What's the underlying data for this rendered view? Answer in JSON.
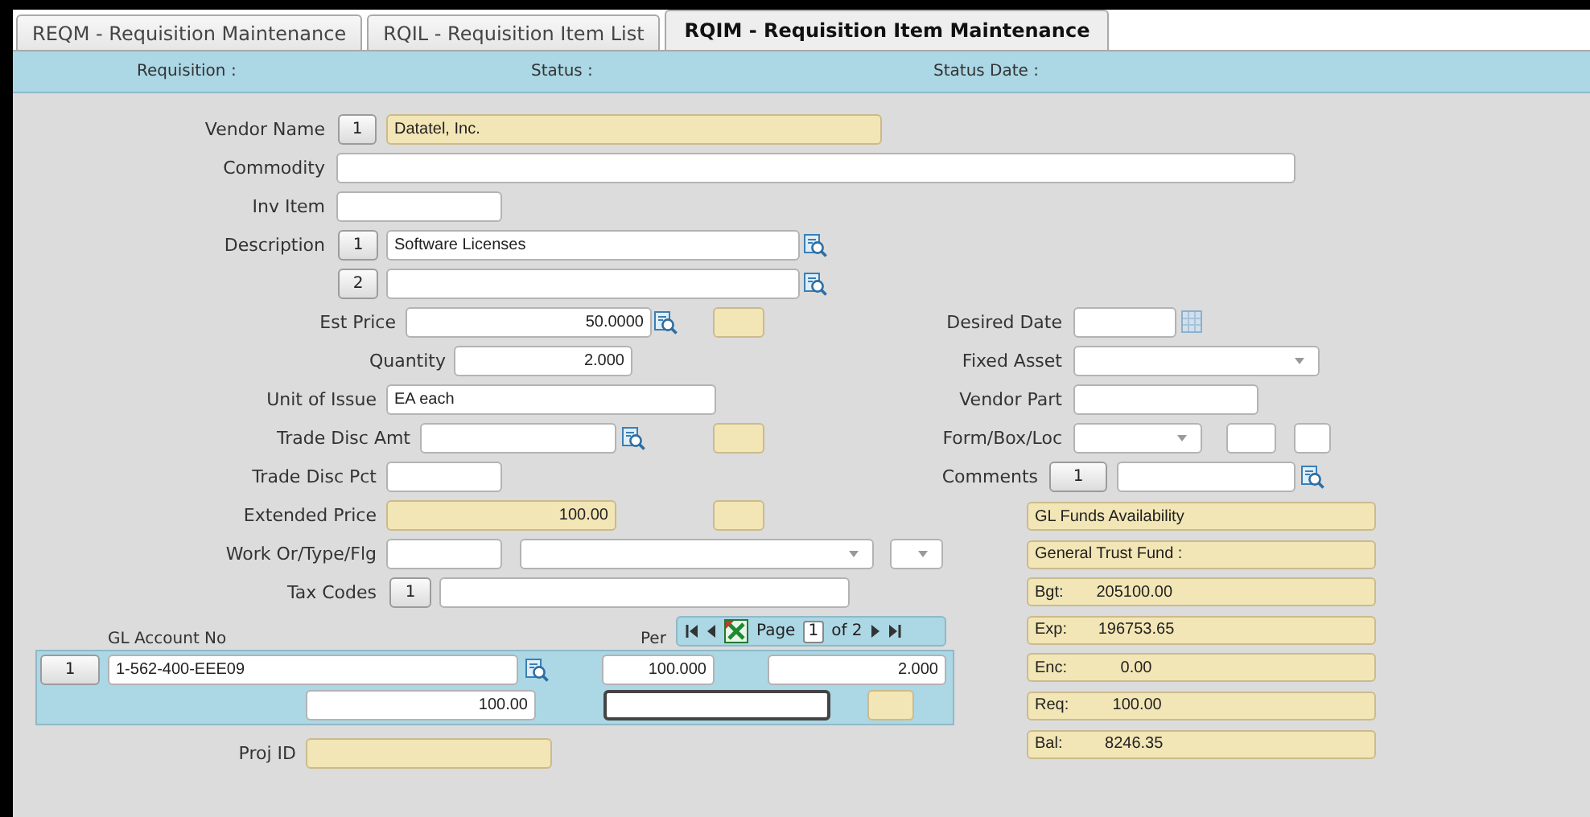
{
  "tabs": [
    {
      "label": "REQM - Requisition Maintenance",
      "selected": false
    },
    {
      "label": "RQIL - Requisition Item List",
      "selected": false
    },
    {
      "label": "RQIM - Requisition Item Maintenance",
      "selected": true
    }
  ],
  "header": [
    "Requisition :",
    "Status :",
    "Status Date :"
  ],
  "item_fields": [
    {
      "label": "Vendor Name",
      "controls": [
        {
          "kind": "button",
          "text": "1"
        },
        {
          "kind": "readonly",
          "value": "Datatel, Inc."
        }
      ]
    },
    {
      "label": "Commodity",
      "controls": [
        {
          "kind": "field"
        }
      ]
    },
    {
      "label": "Inv Item",
      "controls": [
        {
          "kind": "field"
        }
      ]
    },
    {
      "label": "Description",
      "controls": [
        {
          "kind": "button",
          "text": "1"
        },
        {
          "kind": "field",
          "value": "Software Licenses"
        }
      ]
    },
    {
      "controls": [
        {
          "kind": "button",
          "text": "2"
        },
        {
          "kind": "field"
        }
      ]
    },
    {
      "label": "Est Price",
      "controls": [
        {
          "kind": "field",
          "value": "50.0000"
        },
        {
          "kind": "readonly"
        }
      ]
    },
    {
      "label": "Quantity",
      "controls": [
        {
          "kind": "field",
          "value": "2.000"
        }
      ]
    },
    {
      "label": "Unit of Issue",
      "controls": [
        {
          "kind": "field",
          "value": "EA each"
        }
      ]
    },
    {
      "label": "Trade Disc Amt",
      "controls": [
        {
          "kind": "field"
        },
        {
          "kind": "readonly"
        }
      ]
    },
    {
      "label": "Trade Disc Pct",
      "controls": [
        {
          "kind": "field"
        }
      ]
    },
    {
      "label": "Extended Price",
      "controls": [
        {
          "kind": "readonly",
          "value": "100.00"
        },
        {
          "kind": "readonly"
        }
      ]
    },
    {
      "label": "Work Or/Type/Flg",
      "controls": [
        {
          "kind": "field"
        },
        {
          "kind": "dropdown"
        },
        {
          "kind": "dropdown"
        }
      ]
    },
    {
      "label": "Tax Codes",
      "controls": [
        {
          "kind": "button",
          "text": "1"
        },
        {
          "kind": "field"
        }
      ]
    }
  ],
  "detail_fields": [
    {
      "label": "Desired Date",
      "controls": [
        {
          "kind": "field"
        }
      ]
    },
    {
      "label": "Fixed Asset",
      "controls": [
        {
          "kind": "dropdown"
        }
      ]
    },
    {
      "label": "Vendor Part",
      "controls": [
        {
          "kind": "field"
        }
      ]
    },
    {
      "label": "Form/Box/Loc",
      "controls": [
        {
          "kind": "dropdown"
        },
        {
          "kind": "field"
        },
        {
          "kind": "field"
        }
      ]
    },
    {
      "label": "Comments",
      "controls": [
        {
          "kind": "button",
          "text": "1"
        },
        {
          "kind": "field"
        }
      ]
    }
  ],
  "gl_distribution": {
    "columns": [
      "GL Account No",
      "Per"
    ],
    "pager": {
      "label": "Page",
      "page": "1",
      "count": "of 2"
    },
    "lines": [
      {
        "controls": [
          {
            "kind": "button",
            "text": "1"
          },
          {
            "kind": "field",
            "value": "1-562-400-EEE09",
            "focused": false
          },
          {
            "kind": "field",
            "value": "100.000",
            "focused": false
          },
          {
            "kind": "field",
            "value": "2.000",
            "focused": false
          }
        ]
      },
      {
        "controls": [
          {
            "kind": "field",
            "value": "100.00",
            "focused": false
          },
          {
            "kind": "field",
            "focused": true
          },
          {
            "kind": "readonly"
          }
        ]
      }
    ]
  },
  "footer_fields": [
    {
      "label": "Proj ID",
      "controls": [
        {
          "kind": "readonly"
        }
      ]
    }
  ],
  "funds": [
    {
      "label": "GL Funds Availability"
    },
    {
      "label": "General Trust Fund :"
    },
    {
      "label": "Bgt:",
      "amount": "205100.00"
    },
    {
      "label": "Exp:",
      "amount": "196753.65"
    },
    {
      "label": "Enc:",
      "amount": "0.00"
    },
    {
      "label": "Req:",
      "amount": "100.00"
    },
    {
      "label": "Bal:",
      "amount": "8246.35"
    }
  ]
}
